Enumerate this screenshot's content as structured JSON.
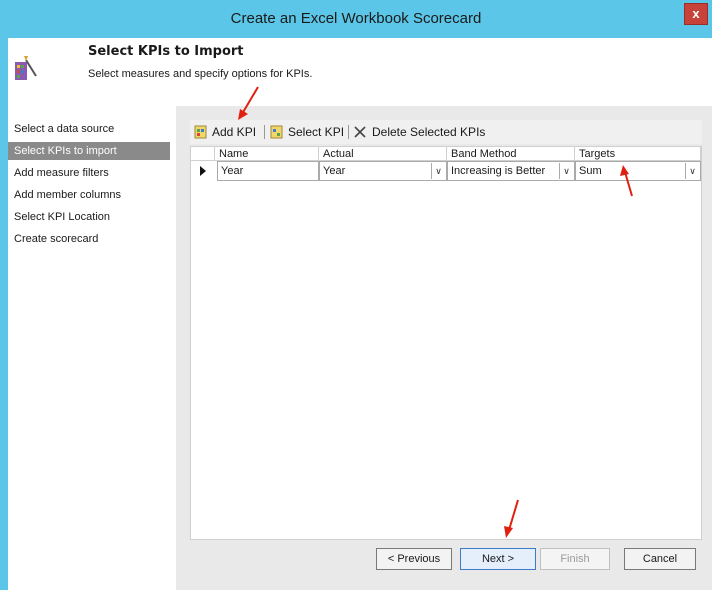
{
  "window": {
    "title": "Create an Excel Workbook Scorecard",
    "close_label": "x"
  },
  "header": {
    "title": "Select KPIs to Import",
    "subtitle": "Select measures and specify options for KPIs."
  },
  "nav": {
    "items": [
      {
        "label": "Select a data source"
      },
      {
        "label": "Select KPIs to import",
        "selected": true
      },
      {
        "label": "Add measure filters"
      },
      {
        "label": "Add member columns"
      },
      {
        "label": "Select KPI Location"
      },
      {
        "label": "Create scorecard"
      }
    ]
  },
  "toolbar": {
    "add_kpi": "Add KPI",
    "select_kpi": "Select KPI",
    "delete": "Delete Selected KPIs"
  },
  "grid": {
    "columns": [
      "Name",
      "Actual",
      "Band Method",
      "Targets"
    ],
    "rows": [
      {
        "name": "Year",
        "actual": "Year",
        "band_method": "Increasing is Better",
        "targets": "Sum"
      }
    ]
  },
  "buttons": {
    "previous": "< Previous",
    "next": "Next >",
    "finish": "Finish",
    "cancel": "Cancel"
  },
  "colors": {
    "titlebar": "#5bc6e8",
    "close": "#c7433a",
    "selected_nav": "#8a8a8a",
    "annotation": "#e02010"
  }
}
